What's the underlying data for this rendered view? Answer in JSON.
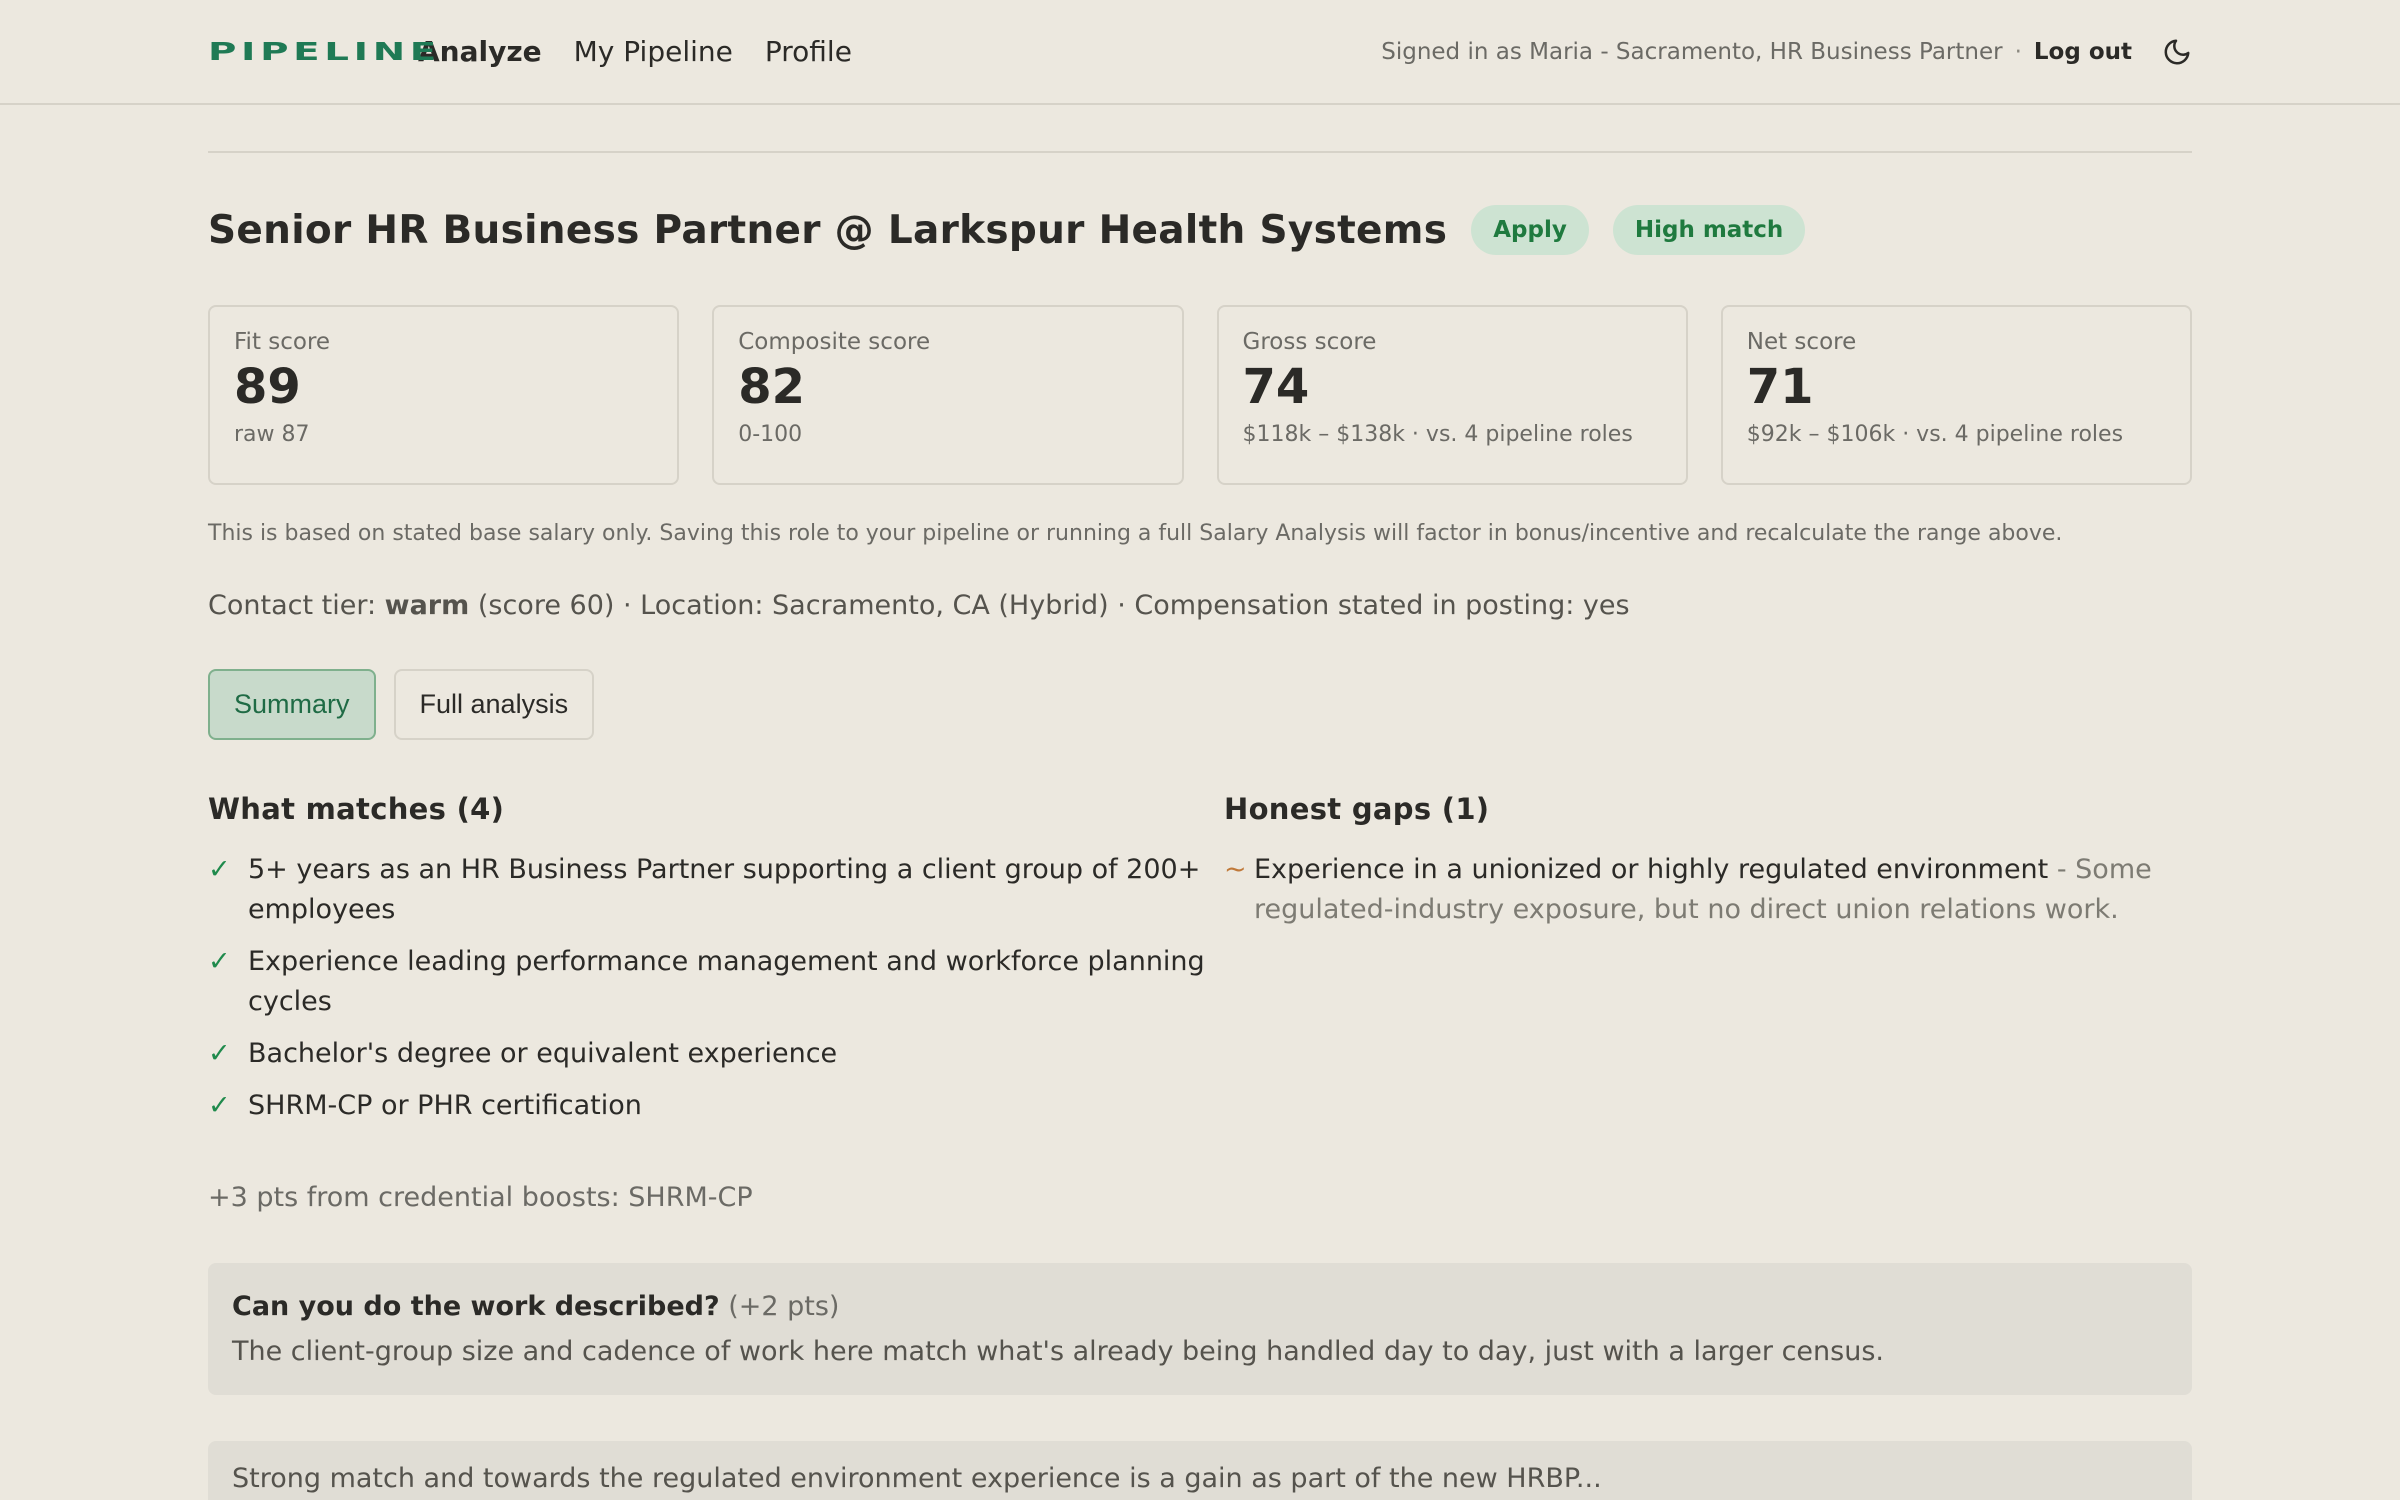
{
  "nav": {
    "logo": "PIPELINE",
    "links": [
      "Analyze",
      "My Pipeline",
      "Profile"
    ],
    "signed_in": "Signed in as Maria - Sacramento, HR Business Partner",
    "separator": "·",
    "logout": "Log out",
    "theme_icon": "moon-icon"
  },
  "job": {
    "title": "Senior HR Business Partner @ Larkspur Health Systems",
    "badges": [
      "Apply",
      "High match"
    ]
  },
  "scores": [
    {
      "label": "Fit score",
      "value": "89",
      "sub": "raw 87"
    },
    {
      "label": "Composite score",
      "value": "82",
      "sub": "0-100"
    },
    {
      "label": "Gross score",
      "value": "74",
      "sub": "$118k – $138k · vs. 4 pipeline roles"
    },
    {
      "label": "Net score",
      "value": "71",
      "sub": "$92k – $106k · vs. 4 pipeline roles"
    }
  ],
  "salary_note": "This is based on stated base salary only. Saving this role to your pipeline or running a full Salary Analysis will factor in bonus/incentive and recalculate the range above.",
  "contact": {
    "prefix": "Contact tier: ",
    "tier": "warm",
    "suffix": " (score 60) · Location: Sacramento, CA (Hybrid) · Compensation stated in posting: yes"
  },
  "tabs": [
    "Summary",
    "Full analysis"
  ],
  "matches": {
    "heading": "What matches (4)",
    "items": [
      "5+ years as an HR Business Partner supporting a client group of 200+ employees",
      "Experience leading performance management and workforce planning cycles",
      "Bachelor's degree or equivalent experience",
      "SHRM-CP or PHR certification"
    ]
  },
  "gaps": {
    "heading": "Honest gaps (1)",
    "items": [
      {
        "title": "Experience in a unionized or highly regulated environment",
        "detail": " - Some regulated-industry exposure, but no direct union relations work."
      }
    ]
  },
  "boost": "+3 pts from credential boosts: SHRM-CP",
  "panel": {
    "question": "Can you do the work described?",
    "pts": " (+2 pts)",
    "body": "The client-group size and cadence of work here match what's already being handled day to day, just with a larger census."
  },
  "panel2_text": "Strong match and towards the regulated environment experience is a gain as part of the new HRBP... "
}
